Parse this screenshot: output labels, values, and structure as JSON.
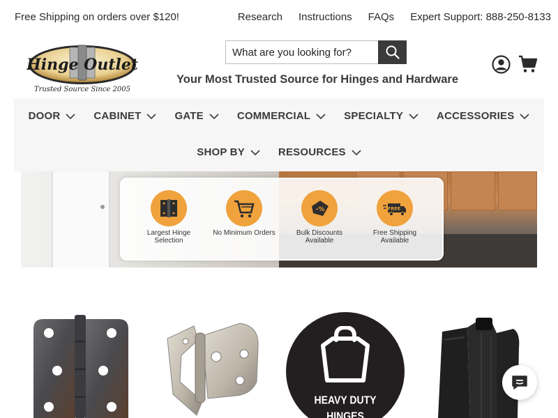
{
  "topbar": {
    "promo": "Free Shipping on orders over $120!",
    "links": [
      "Research",
      "Instructions",
      "FAQs",
      "Expert Support: 888-250-8133"
    ]
  },
  "logo": {
    "name": "Hinge Outlet",
    "subtitle": "Trusted Source Since 2005"
  },
  "search": {
    "placeholder": "What are you looking for?",
    "icon": "search-icon"
  },
  "tagline": "Your Most Trusted Source for Hinges and Hardware",
  "header_icons": [
    "account-icon",
    "cart-icon"
  ],
  "nav": {
    "row1": [
      "DOOR",
      "CABINET",
      "GATE",
      "COMMERCIAL",
      "SPECIALTY",
      "ACCESSORIES"
    ],
    "row2": [
      "SHOP BY",
      "RESOURCES"
    ]
  },
  "banner": {
    "features": [
      {
        "label": "Largest Hinge Selection",
        "icon": "hinge-icon"
      },
      {
        "label": "No Minimum Orders",
        "icon": "shopping-cart-icon"
      },
      {
        "label": "Bulk Discounts Available",
        "icon": "discount-tag-icon"
      },
      {
        "label": "Free Shipping Available",
        "icon": "free-shipping-truck-icon",
        "icon_text": "FREE"
      }
    ]
  },
  "products": [
    {
      "name": "door-hinge",
      "icon": "door-hinge-icon"
    },
    {
      "name": "cabinet-hinge",
      "icon": "cabinet-hinge-icon"
    },
    {
      "name": "heavy-duty-hinges",
      "label_line1": "HEAVY DUTY",
      "label_line2": "HINGES"
    },
    {
      "name": "gate-hinge",
      "icon": "gate-hinge-icon"
    }
  ],
  "chat": {
    "icon": "chat-icon"
  },
  "colors": {
    "accent_orange": "#f0a23c",
    "dark": "#3a3a3a",
    "nav_bg": "#f6f6f6"
  }
}
